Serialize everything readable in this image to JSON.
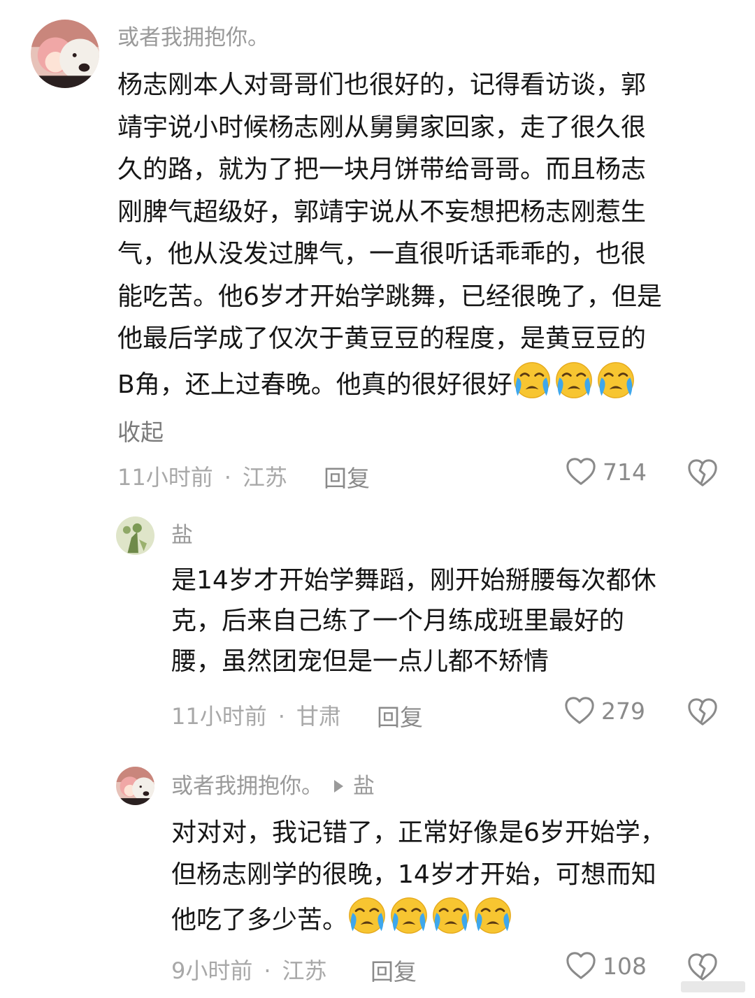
{
  "comments": [
    {
      "username": "或者我拥抱你。",
      "lines": [
        "杨志刚本人对哥哥们也很好的，记得看访谈，郭",
        "靖宇说小时候杨志刚从舅舅家回家，走了很久很",
        "久的路，就为了把一块月饼带给哥哥。而且杨志",
        "刚脾气超级好，郭靖宇说从不妄想把杨志刚惹生",
        "气，他从没发过脾气，一直很听话乖乖的，也很",
        "能吃苦。他6岁才开始学跳舞，已经很晚了，但是",
        "他最后学成了仅次于黄豆豆的程度，是黄豆豆的",
        "B角，还上过春晚。他真的很好很好"
      ],
      "emoji": "crying-emoji",
      "collapse_label": "收起",
      "time": "11小时前",
      "dot": "·",
      "location": "江苏",
      "reply_label": "回复",
      "likes": "714"
    },
    {
      "username": "盐",
      "lines": [
        "是14岁才开始学舞蹈，刚开始掰腰每次都休",
        "克，后来自己练了一个月练成班里最好的",
        "腰，虽然团宠但是一点儿都不矫情"
      ],
      "time": "11小时前",
      "dot": "·",
      "location": "甘肃",
      "reply_label": "回复",
      "likes": "279"
    },
    {
      "username": "或者我拥抱你。",
      "reply_to": "盐",
      "lines": [
        "对对对，我记错了，正常好像是6岁开始学，",
        "但杨志刚学的很晚，14岁才开始，可想而知",
        "他吃了多少苦。"
      ],
      "emoji": "crying-emoji",
      "time": "9小时前",
      "dot": "·",
      "location": "江苏",
      "reply_label": "回复",
      "likes": "108"
    }
  ],
  "colors": {
    "text": "#161616",
    "meta": "#a8a8a8",
    "username": "#9a9a9a",
    "emoji_face": "#f7c531",
    "emoji_tears": "#3ea7ec"
  }
}
